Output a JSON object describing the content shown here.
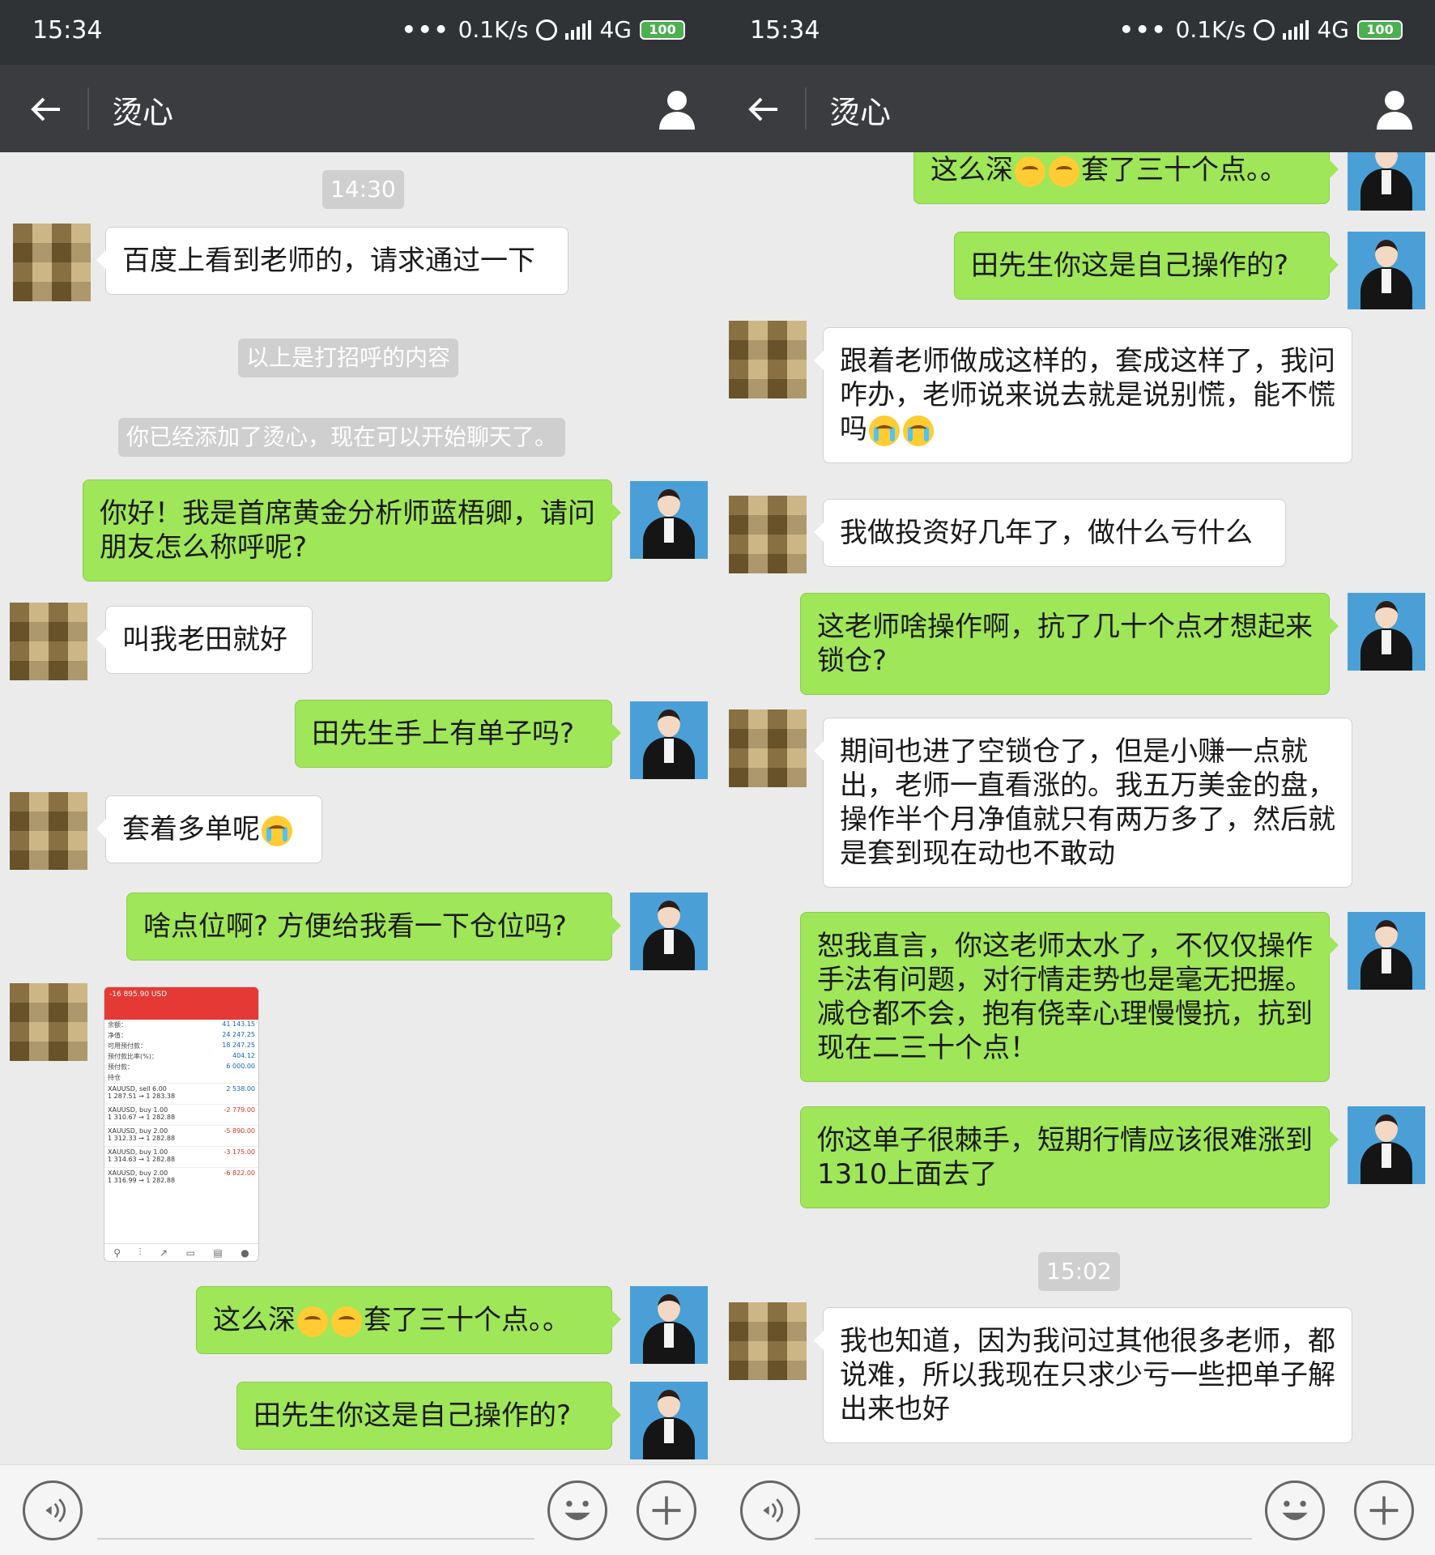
{
  "status": {
    "time": "15:34",
    "speed": "0.1K/s",
    "network": "4G",
    "battery": "100"
  },
  "header": {
    "title": "烫心"
  },
  "left": {
    "timestamp": "14:30",
    "messages": [
      {
        "text": "百度上看到老师的，请求通过一下"
      },
      {
        "text": "以上是打招呼的内容"
      },
      {
        "text": "你已经添加了烫心，现在可以开始聊天了。"
      },
      {
        "text": "你好！我是首席黄金分析师蓝梧卿，请问朋友怎么称呼呢?"
      },
      {
        "text": "叫我老田就好"
      },
      {
        "text": "田先生手上有单子吗?"
      },
      {
        "text": "套着多单呢"
      },
      {
        "text": "啥点位啊? 方便给我看一下仓位吗?"
      },
      {
        "text": "这么深"
      },
      {
        "text": "套了三十个点。。"
      },
      {
        "text": "田先生你这是自己操作的?"
      }
    ],
    "screenshot": {
      "balance": "-16 895.90 USD",
      "rows": [
        {
          "k": "余额：",
          "v": "41 143.15"
        },
        {
          "k": "净值：",
          "v": "24 247.25"
        },
        {
          "k": "可用预付款：",
          "v": "18 247.25"
        },
        {
          "k": "预付款比率(%)：",
          "v": "404.12"
        },
        {
          "k": "预付款：",
          "v": "6 000.00"
        }
      ],
      "positions_label": "持仓",
      "trades": [
        {
          "sym": "XAUUSD, sell 6.00",
          "px": "1 287.51 → 1 283.38",
          "pl": "2 538.00"
        },
        {
          "sym": "XAUUSD, buy 1.00",
          "px": "1 310.67 → 1 282.88",
          "pl": "-2 779.00"
        },
        {
          "sym": "XAUUSD, buy 2.00",
          "px": "1 312.33 → 1 282.88",
          "pl": "-5 890.00"
        },
        {
          "sym": "XAUUSD, buy 1.00",
          "px": "1 314.63 → 1 282.88",
          "pl": "-3 175.00"
        },
        {
          "sym": "XAUUSD, buy 2.00",
          "px": "1 316.99 → 1 282.88",
          "pl": "-6 822.00"
        }
      ]
    }
  },
  "right": {
    "timestamp": "15:02",
    "messages": [
      {
        "text": "这么深"
      },
      {
        "text": "套了三十个点。。"
      },
      {
        "text": "田先生你这是自己操作的?"
      },
      {
        "text": "跟着老师做成这样的，套成这样了，我问咋办，老师说来说去就是说别慌，能不慌吗"
      },
      {
        "text": "我做投资好几年了，做什么亏什么"
      },
      {
        "text": "这老师啥操作啊，抗了几十个点才想起来锁仓?"
      },
      {
        "text": "期间也进了空锁仓了，但是小赚一点就出，老师一直看涨的。我五万美金的盘，操作半个月净值就只有两万多了，然后就是套到现在动也不敢动"
      },
      {
        "text": "恕我直言，你这老师太水了，不仅仅操作手法有问题，对行情走势也是毫无把握。减仓都不会，抱有侥幸心理慢慢抗，抗到现在二三十个点！"
      },
      {
        "text": "你这单子很棘手，短期行情应该很难涨到1310上面去了"
      },
      {
        "text": "我也知道，因为我问过其他很多老师，都说难，所以我现在只求少亏一些把单子解出来也好"
      }
    ]
  },
  "icons": [
    "back-arrow-icon",
    "contact-icon",
    "alarm-icon",
    "signal-icon",
    "battery-icon",
    "voice-icon",
    "emoji-icon",
    "plus-icon"
  ]
}
